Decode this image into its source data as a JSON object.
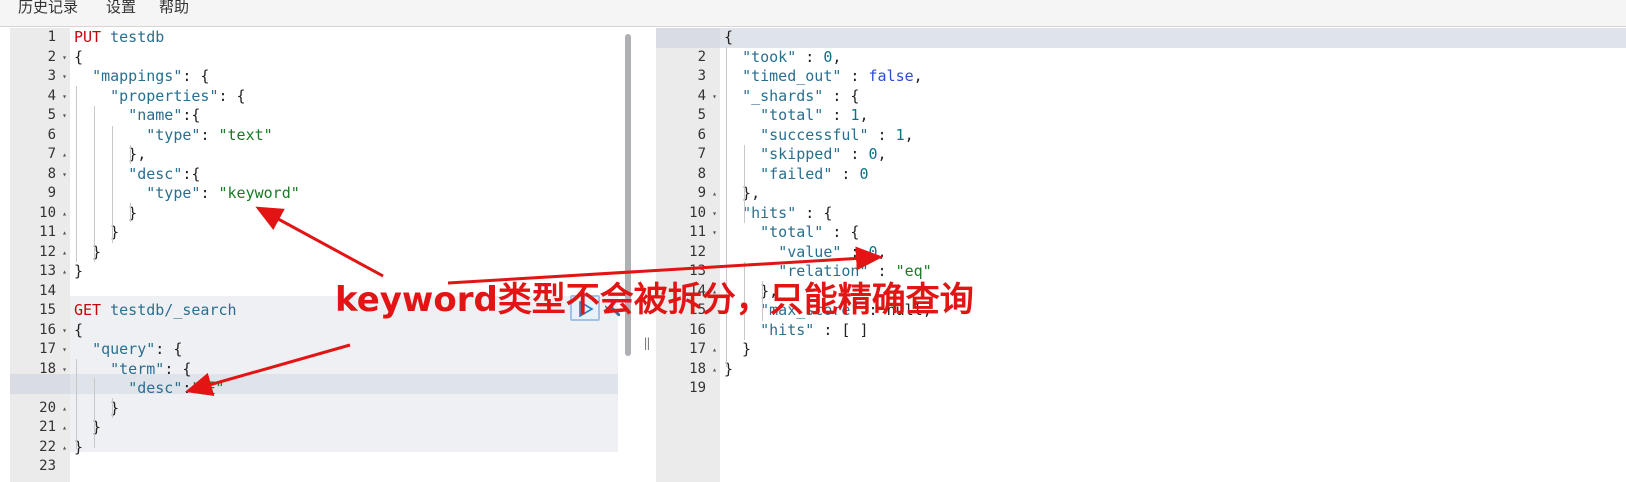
{
  "menubar": {
    "items": [
      "历史记录",
      "设置",
      "帮助"
    ]
  },
  "request_editor": {
    "lines": [
      {
        "num": "1",
        "fold": "",
        "tokens": [
          {
            "c": "tk-m",
            "t": "PUT"
          },
          {
            "c": "tk-p",
            "t": " "
          },
          {
            "c": "tk-k",
            "t": "testdb"
          }
        ]
      },
      {
        "num": "2",
        "fold": "▾",
        "tokens": [
          {
            "c": "tk-p",
            "t": "{"
          }
        ]
      },
      {
        "num": "3",
        "fold": "▾",
        "tokens": [
          {
            "c": "tk-p",
            "t": "  "
          },
          {
            "c": "tk-k",
            "t": "\"mappings\""
          },
          {
            "c": "tk-p",
            "t": ": {"
          }
        ]
      },
      {
        "num": "4",
        "fold": "▾",
        "tokens": [
          {
            "c": "tk-p",
            "t": "    "
          },
          {
            "c": "tk-k",
            "t": "\"properties\""
          },
          {
            "c": "tk-p",
            "t": ": {"
          }
        ]
      },
      {
        "num": "5",
        "fold": "▾",
        "tokens": [
          {
            "c": "tk-p",
            "t": "      "
          },
          {
            "c": "tk-k",
            "t": "\"name\""
          },
          {
            "c": "tk-p",
            "t": ":{"
          }
        ]
      },
      {
        "num": "6",
        "fold": "",
        "tokens": [
          {
            "c": "tk-p",
            "t": "        "
          },
          {
            "c": "tk-k",
            "t": "\"type\""
          },
          {
            "c": "tk-p",
            "t": ": "
          },
          {
            "c": "tk-s",
            "t": "\"text\""
          }
        ]
      },
      {
        "num": "7",
        "fold": "▴",
        "tokens": [
          {
            "c": "tk-p",
            "t": "      },"
          }
        ]
      },
      {
        "num": "8",
        "fold": "▾",
        "tokens": [
          {
            "c": "tk-p",
            "t": "      "
          },
          {
            "c": "tk-k",
            "t": "\"desc\""
          },
          {
            "c": "tk-p",
            "t": ":{"
          }
        ]
      },
      {
        "num": "9",
        "fold": "",
        "tokens": [
          {
            "c": "tk-p",
            "t": "        "
          },
          {
            "c": "tk-k",
            "t": "\"type\""
          },
          {
            "c": "tk-p",
            "t": ": "
          },
          {
            "c": "tk-s",
            "t": "\"keyword\""
          }
        ]
      },
      {
        "num": "10",
        "fold": "▴",
        "tokens": [
          {
            "c": "tk-p",
            "t": "      }"
          }
        ]
      },
      {
        "num": "11",
        "fold": "▴",
        "tokens": [
          {
            "c": "tk-p",
            "t": "    }"
          }
        ]
      },
      {
        "num": "12",
        "fold": "▴",
        "tokens": [
          {
            "c": "tk-p",
            "t": "  }"
          }
        ]
      },
      {
        "num": "13",
        "fold": "▴",
        "tokens": [
          {
            "c": "tk-p",
            "t": "}"
          }
        ]
      },
      {
        "num": "14",
        "fold": "",
        "tokens": []
      },
      {
        "num": "15",
        "fold": "",
        "tokens": [
          {
            "c": "tk-m",
            "t": "GET"
          },
          {
            "c": "tk-p",
            "t": " "
          },
          {
            "c": "tk-k",
            "t": "testdb/_search"
          }
        ]
      },
      {
        "num": "16",
        "fold": "▾",
        "tokens": [
          {
            "c": "tk-p",
            "t": "{"
          }
        ]
      },
      {
        "num": "17",
        "fold": "▾",
        "tokens": [
          {
            "c": "tk-p",
            "t": "  "
          },
          {
            "c": "tk-k",
            "t": "\"query\""
          },
          {
            "c": "tk-p",
            "t": ": {"
          }
        ]
      },
      {
        "num": "18",
        "fold": "▾",
        "tokens": [
          {
            "c": "tk-p",
            "t": "    "
          },
          {
            "c": "tk-k",
            "t": "\"term\""
          },
          {
            "c": "tk-p",
            "t": ": {"
          }
        ]
      },
      {
        "num": "19",
        "fold": "",
        "tokens": [
          {
            "c": "tk-p",
            "t": "      "
          },
          {
            "c": "tk-k",
            "t": "\"desc\""
          },
          {
            "c": "tk-p",
            "t": ":"
          },
          {
            "c": "tk-s",
            "t": "\"狂\""
          }
        ]
      },
      {
        "num": "20",
        "fold": "▴",
        "tokens": [
          {
            "c": "tk-p",
            "t": "    }"
          }
        ]
      },
      {
        "num": "21",
        "fold": "▴",
        "tokens": [
          {
            "c": "tk-p",
            "t": "  }"
          }
        ]
      },
      {
        "num": "22",
        "fold": "▴",
        "tokens": [
          {
            "c": "tk-p",
            "t": "}"
          }
        ]
      },
      {
        "num": "23",
        "fold": "",
        "tokens": []
      }
    ]
  },
  "response_viewer": {
    "lines": [
      {
        "num": "1",
        "fold": "▾",
        "tokens": [
          {
            "c": "tk-p",
            "t": "{"
          }
        ]
      },
      {
        "num": "2",
        "fold": "",
        "tokens": [
          {
            "c": "tk-p",
            "t": "  "
          },
          {
            "c": "tk-k",
            "t": "\"took\""
          },
          {
            "c": "tk-p",
            "t": " : "
          },
          {
            "c": "tk-n",
            "t": "0"
          },
          {
            "c": "tk-p",
            "t": ","
          }
        ]
      },
      {
        "num": "3",
        "fold": "",
        "tokens": [
          {
            "c": "tk-p",
            "t": "  "
          },
          {
            "c": "tk-k",
            "t": "\"timed_out\""
          },
          {
            "c": "tk-p",
            "t": " : "
          },
          {
            "c": "tk-b",
            "t": "false"
          },
          {
            "c": "tk-p",
            "t": ","
          }
        ]
      },
      {
        "num": "4",
        "fold": "▾",
        "tokens": [
          {
            "c": "tk-p",
            "t": "  "
          },
          {
            "c": "tk-k",
            "t": "\"_shards\""
          },
          {
            "c": "tk-p",
            "t": " : {"
          }
        ]
      },
      {
        "num": "5",
        "fold": "",
        "tokens": [
          {
            "c": "tk-p",
            "t": "    "
          },
          {
            "c": "tk-k",
            "t": "\"total\""
          },
          {
            "c": "tk-p",
            "t": " : "
          },
          {
            "c": "tk-n",
            "t": "1"
          },
          {
            "c": "tk-p",
            "t": ","
          }
        ]
      },
      {
        "num": "6",
        "fold": "",
        "tokens": [
          {
            "c": "tk-p",
            "t": "    "
          },
          {
            "c": "tk-k",
            "t": "\"successful\""
          },
          {
            "c": "tk-p",
            "t": " : "
          },
          {
            "c": "tk-n",
            "t": "1"
          },
          {
            "c": "tk-p",
            "t": ","
          }
        ]
      },
      {
        "num": "7",
        "fold": "",
        "tokens": [
          {
            "c": "tk-p",
            "t": "    "
          },
          {
            "c": "tk-k",
            "t": "\"skipped\""
          },
          {
            "c": "tk-p",
            "t": " : "
          },
          {
            "c": "tk-n",
            "t": "0"
          },
          {
            "c": "tk-p",
            "t": ","
          }
        ]
      },
      {
        "num": "8",
        "fold": "",
        "tokens": [
          {
            "c": "tk-p",
            "t": "    "
          },
          {
            "c": "tk-k",
            "t": "\"failed\""
          },
          {
            "c": "tk-p",
            "t": " : "
          },
          {
            "c": "tk-n",
            "t": "0"
          }
        ]
      },
      {
        "num": "9",
        "fold": "▴",
        "tokens": [
          {
            "c": "tk-p",
            "t": "  },"
          }
        ]
      },
      {
        "num": "10",
        "fold": "▾",
        "tokens": [
          {
            "c": "tk-p",
            "t": "  "
          },
          {
            "c": "tk-k",
            "t": "\"hits\""
          },
          {
            "c": "tk-p",
            "t": " : {"
          }
        ]
      },
      {
        "num": "11",
        "fold": "▾",
        "tokens": [
          {
            "c": "tk-p",
            "t": "    "
          },
          {
            "c": "tk-k",
            "t": "\"total\""
          },
          {
            "c": "tk-p",
            "t": " : {"
          }
        ]
      },
      {
        "num": "12",
        "fold": "",
        "tokens": [
          {
            "c": "tk-p",
            "t": "      "
          },
          {
            "c": "tk-k",
            "t": "\"value\""
          },
          {
            "c": "tk-p",
            "t": " : "
          },
          {
            "c": "tk-n",
            "t": "0"
          },
          {
            "c": "tk-p",
            "t": ","
          }
        ]
      },
      {
        "num": "13",
        "fold": "",
        "tokens": [
          {
            "c": "tk-p",
            "t": "      "
          },
          {
            "c": "tk-k",
            "t": "\"relation\""
          },
          {
            "c": "tk-p",
            "t": " : "
          },
          {
            "c": "tk-s",
            "t": "\"eq\""
          }
        ]
      },
      {
        "num": "14",
        "fold": "▴",
        "tokens": [
          {
            "c": "tk-p",
            "t": "    },"
          }
        ]
      },
      {
        "num": "15",
        "fold": "",
        "tokens": [
          {
            "c": "tk-p",
            "t": "    "
          },
          {
            "c": "tk-k",
            "t": "\"max_score\""
          },
          {
            "c": "tk-p",
            "t": " : "
          },
          {
            "c": "tk-p",
            "t": "null"
          },
          {
            "c": "tk-p",
            "t": ","
          }
        ]
      },
      {
        "num": "16",
        "fold": "",
        "tokens": [
          {
            "c": "tk-p",
            "t": "    "
          },
          {
            "c": "tk-k",
            "t": "\"hits\""
          },
          {
            "c": "tk-p",
            "t": " : [ ]"
          }
        ]
      },
      {
        "num": "17",
        "fold": "▴",
        "tokens": [
          {
            "c": "tk-p",
            "t": "  }"
          }
        ]
      },
      {
        "num": "18",
        "fold": "▴",
        "tokens": [
          {
            "c": "tk-p",
            "t": "}"
          }
        ]
      },
      {
        "num": "19",
        "fold": "",
        "tokens": []
      }
    ]
  },
  "annotation": {
    "text": "keyword类型不会被拆分，只能精确查询",
    "color": "#e21414"
  },
  "colors": {
    "method": "#c5060b",
    "key": "#2a6f8f",
    "string": "#1a7a26",
    "number": "#0b7285",
    "boolean": "#2b4bd6"
  },
  "icons": {
    "run": "play-icon",
    "settings": "wrench-icon",
    "fold_open": "fold-open-icon",
    "fold_closed": "fold-close-icon",
    "resize": "resize-handle-icon"
  }
}
